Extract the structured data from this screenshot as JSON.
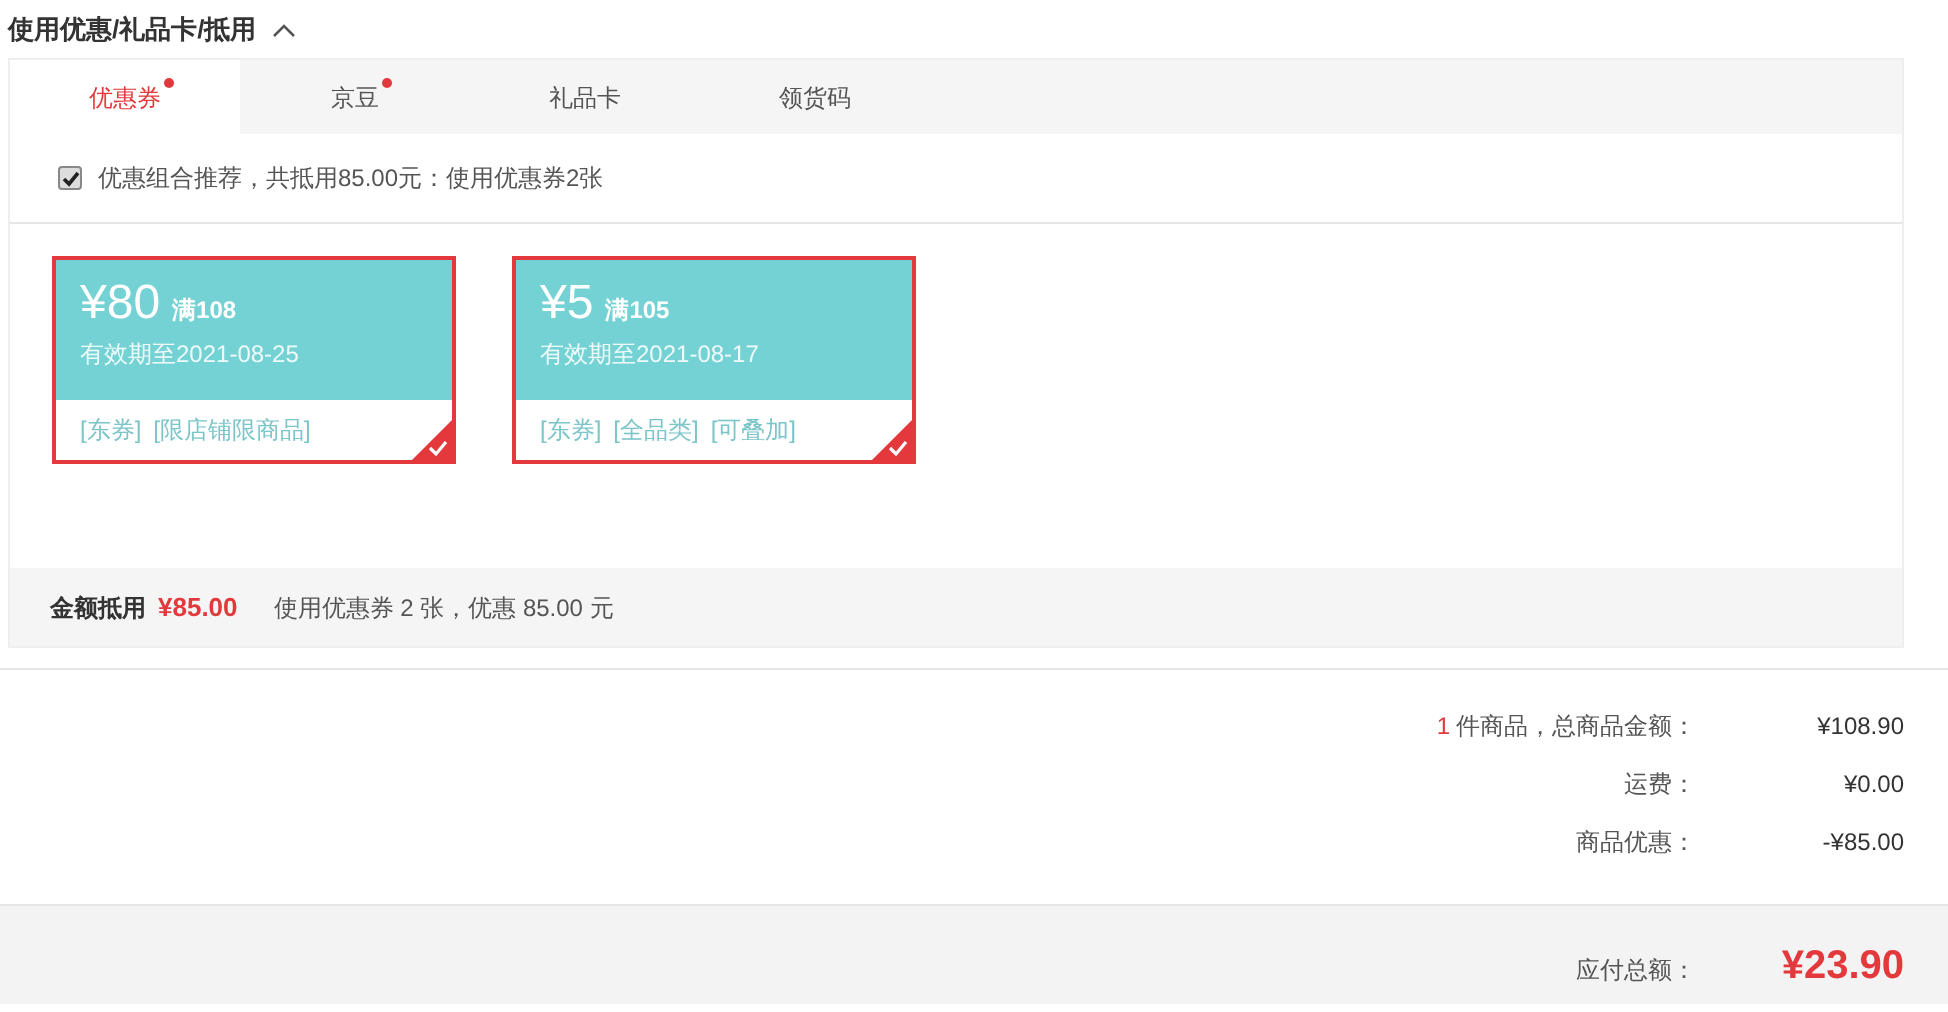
{
  "section_title": "使用优惠/礼品卡/抵用",
  "expanded": true,
  "tabs": [
    {
      "label": "优惠券",
      "selected": true,
      "dot": true
    },
    {
      "label": "京豆",
      "selected": false,
      "dot": true
    },
    {
      "label": "礼品卡",
      "selected": false,
      "dot": false
    },
    {
      "label": "领货码",
      "selected": false,
      "dot": false
    }
  ],
  "recommend": {
    "checked": true,
    "label": "优惠组合推荐，共抵用85.00元：使用优惠券2张"
  },
  "coupons": [
    {
      "amount": "¥80",
      "condition": "满108",
      "validity": "有效期至2021-08-25",
      "tags": [
        "[东券]",
        "[限店铺限商品]"
      ],
      "selected": true
    },
    {
      "amount": "¥5",
      "condition": "满105",
      "validity": "有效期至2021-08-17",
      "tags": [
        "[东券]",
        "[全品类]",
        "[可叠加]"
      ],
      "selected": true
    }
  ],
  "deduction": {
    "label": "金额抵用",
    "amount": "¥85.00",
    "note": "使用优惠券 2 张，优惠 85.00 元"
  },
  "totals": [
    {
      "count": "1",
      "label": "件商品，总商品金额：",
      "value": "¥108.90"
    },
    {
      "label": "运费：",
      "value": "¥0.00"
    },
    {
      "label": "商品优惠：",
      "value": "-¥85.00"
    }
  ],
  "payable": {
    "label": "应付总额：",
    "value": "¥23.90"
  }
}
